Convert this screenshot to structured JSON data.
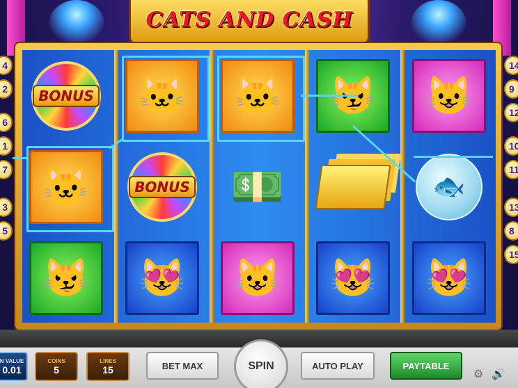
{
  "game": {
    "title": "CATS AND CASH"
  },
  "reels": [
    [
      {
        "symbol": "bonus-wheel",
        "label": "BONUS"
      },
      {
        "symbol": "gangster-cat",
        "bg": "orange",
        "glyph": "🐱"
      },
      {
        "symbol": "tabby-cat",
        "bg": "green",
        "glyph": "😼"
      }
    ],
    [
      {
        "symbol": "gangster-cat",
        "bg": "orange",
        "glyph": "🐱"
      },
      {
        "symbol": "bonus-wheel",
        "label": "BONUS"
      },
      {
        "symbol": "showgirl-cat",
        "bg": "blue",
        "glyph": "😻"
      }
    ],
    [
      {
        "symbol": "gangster-cat",
        "bg": "orange",
        "glyph": "🐱"
      },
      {
        "symbol": "cash-stack",
        "glyph": "💵"
      },
      {
        "symbol": "fluffy-cat",
        "bg": "magenta",
        "glyph": "😺"
      }
    ],
    [
      {
        "symbol": "tabby-cat",
        "bg": "green",
        "glyph": "😼"
      },
      {
        "symbol": "gold-bars",
        "glyph": ""
      },
      {
        "symbol": "showgirl-cat",
        "bg": "blue",
        "glyph": "😻"
      }
    ],
    [
      {
        "symbol": "fluffy-cat",
        "bg": "magenta",
        "glyph": "😺"
      },
      {
        "symbol": "fish-bowl",
        "glyph": "🐟"
      },
      {
        "symbol": "showgirl-cat",
        "bg": "blue",
        "glyph": "😻"
      }
    ]
  ],
  "paylines": {
    "left": [
      "4",
      "2",
      "6",
      "1",
      "7",
      "3",
      "5"
    ],
    "right": [
      "14",
      "9",
      "12",
      "10",
      "11",
      "13",
      "8",
      "15"
    ]
  },
  "controls": {
    "coin_value_label": "N VALUE",
    "coin_value": "0.01",
    "coins_label": "COINS",
    "coins": "5",
    "lines_label": "LINES",
    "lines": "15",
    "bet_max": "BET MAX",
    "spin": "SPIN",
    "auto_play": "AUTO PLAY",
    "paytable": "PAYTABLE"
  },
  "colors": {
    "payline": "#59d6f5",
    "frame_gold": "#f6c94a",
    "reel_blue": "#2e8cf0"
  }
}
